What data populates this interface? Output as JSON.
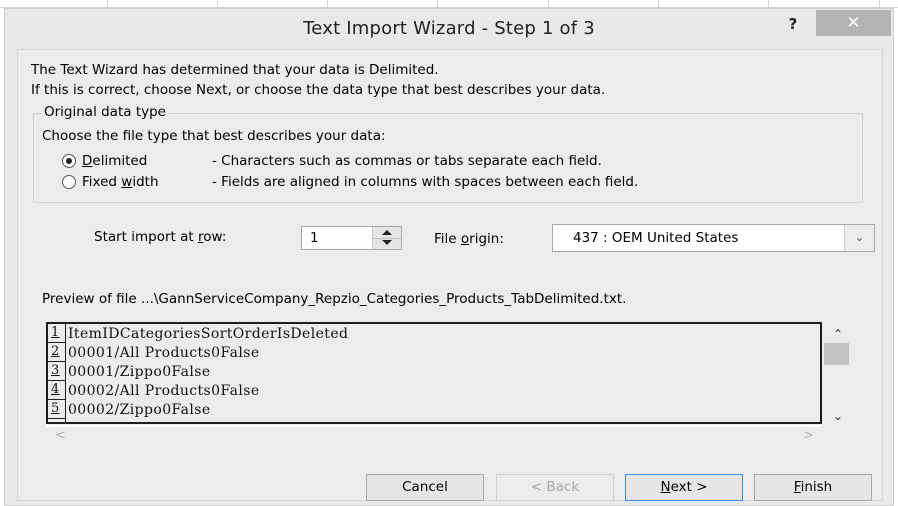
{
  "window": {
    "title": "Text Import Wizard - Step 1 of 3",
    "help_label": "?",
    "close_label": "✕"
  },
  "intro": {
    "line1": "The Text Wizard has determined that your data is Delimited.",
    "line2": "If this is correct, choose Next, or choose the data type that best describes your data."
  },
  "original_data_type": {
    "legend": "Original data type",
    "description": "Choose the file type that best describes your data:",
    "options": [
      {
        "label_accel": "D",
        "label_rest": "elimited",
        "description": "- Characters such as commas or tabs separate each field.",
        "selected": true
      },
      {
        "label_pre": "Fixed ",
        "label_accel": "w",
        "label_rest": "idth",
        "description": "- Fields are aligned in columns with spaces between each field.",
        "selected": false
      }
    ]
  },
  "start_row": {
    "label_pre": "Start import at ",
    "label_accel": "r",
    "label_rest": "ow:",
    "value": "1"
  },
  "file_origin": {
    "label_pre": "File ",
    "label_accel": "o",
    "label_rest": "rigin:",
    "value": "437 : OEM United States",
    "dropdown_icon": "⌄"
  },
  "preview": {
    "label": "Preview of file ...\\GannServiceCompany_Repzio_Categories_Products_TabDelimited.txt.",
    "rows": [
      {
        "num": "1",
        "text": "ItemIDCategoriesSortOrderIsDeleted"
      },
      {
        "num": "2",
        "text": "00001/All Products0False"
      },
      {
        "num": "3",
        "text": "00001/Zippo0False"
      },
      {
        "num": "4",
        "text": "00002/All Products0False"
      },
      {
        "num": "5",
        "text": "00002/Zippo0False"
      }
    ],
    "scroll_up": "^",
    "scroll_down": "v",
    "scroll_left": "<",
    "scroll_right": ">"
  },
  "buttons": {
    "cancel": "Cancel",
    "back": "< Back",
    "next_accel": "N",
    "next_rest": "ext >",
    "finish_accel": "F",
    "finish_rest": "inish"
  }
}
